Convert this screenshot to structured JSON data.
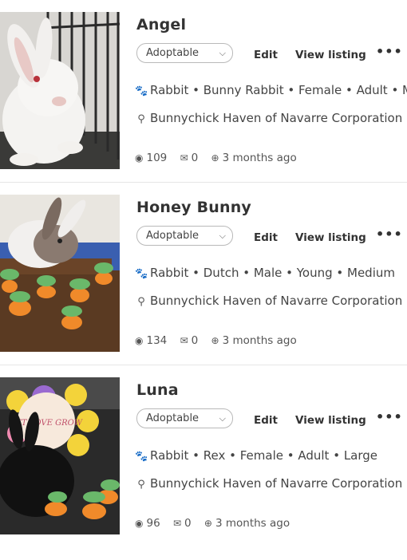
{
  "listings": [
    {
      "name": "Angel",
      "status": "Adoptable",
      "edit_label": "Edit",
      "view_label": "View listing",
      "more_label": "•••",
      "details": "Rabbit • Bunny Rabbit • Female • Adult • M",
      "location": "Bunnychick Haven of Navarre Corporation",
      "views": "109",
      "messages": "0",
      "age": "3 months ago"
    },
    {
      "name": "Honey Bunny",
      "status": "Adoptable",
      "edit_label": "Edit",
      "view_label": "View listing",
      "more_label": "•••",
      "details": "Rabbit • Dutch • Male • Young • Medium",
      "location": "Bunnychick Haven of Navarre Corporation",
      "views": "134",
      "messages": "0",
      "age": "3 months ago"
    },
    {
      "name": "Luna",
      "status": "Adoptable",
      "edit_label": "Edit",
      "view_label": "View listing",
      "more_label": "•••",
      "details": "Rabbit • Rex • Female • Adult • Large",
      "location": "Bunnychick Haven of Navarre Corporation",
      "views": "96",
      "messages": "0",
      "age": "3 months ago",
      "photo_sign_text": "LET LOVE GROW"
    }
  ],
  "icons": {
    "paw": "paw-icon",
    "location": "map-pin-icon",
    "views": "eye-icon",
    "messages": "envelope-icon",
    "age": "plus-circle-icon",
    "dropdown": "chevron-down-icon"
  },
  "colors": {
    "text": "#333333",
    "divider": "#e6e6e6",
    "dropdown_border": "#b9b9b9"
  }
}
